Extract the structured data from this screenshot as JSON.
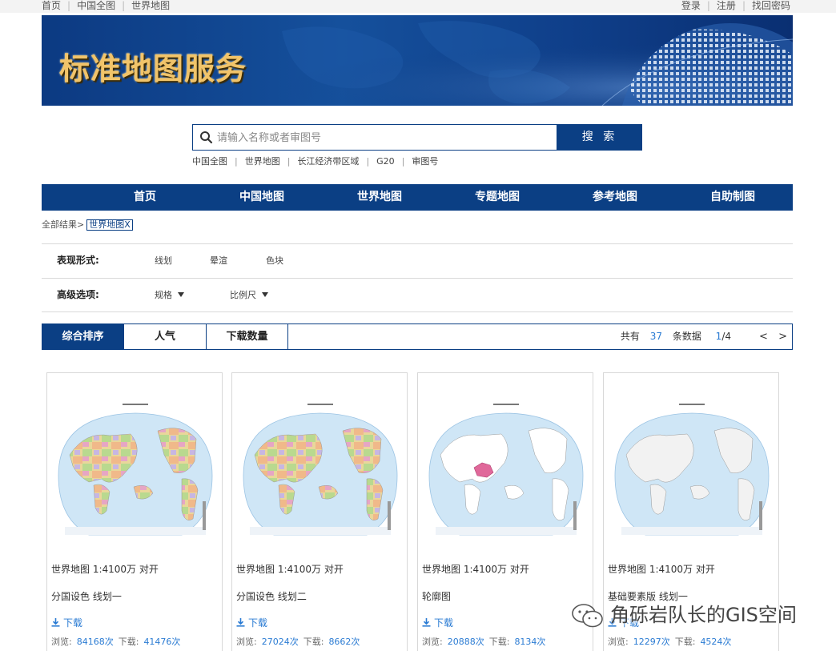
{
  "top_links": {
    "left": [
      "首页",
      "中国全图",
      "世界地图"
    ],
    "right": [
      "登录",
      "注册",
      "找回密码"
    ]
  },
  "banner": {
    "title": "标准地图服务"
  },
  "search": {
    "placeholder": "请输入名称或者审图号",
    "button": "搜 索",
    "quick_links": [
      "中国全图",
      "世界地图",
      "长江经济带区域",
      "G20",
      "审图号"
    ]
  },
  "nav": [
    "首页",
    "中国地图",
    "世界地图",
    "专题地图",
    "参考地图",
    "自助制图"
  ],
  "breadcrumb": {
    "prefix": "全部结果>",
    "tag": "世界地图X"
  },
  "filters": {
    "form_label": "表现形式:",
    "form_options": [
      "线划",
      "晕渲",
      "色块"
    ],
    "advanced_label": "高级选项:",
    "advanced_options": [
      "规格",
      "比例尺"
    ]
  },
  "sortbar": {
    "tabs": [
      "综合排序",
      "人气",
      "下载数量"
    ],
    "count_prefix": "共有",
    "count_value": "37",
    "count_suffix": "条数据",
    "page_current": "1",
    "page_total": "/4",
    "prev": "<",
    "next": ">"
  },
  "cards": [
    {
      "name": "世界地图 1:4100万 对开",
      "sub": "分国设色 线划一",
      "download": "下载",
      "views_label": "浏览:",
      "views": "84168次",
      "downloads_label": "下载:",
      "downloads": "41476次",
      "style": "political"
    },
    {
      "name": "世界地图 1:4100万 对开",
      "sub": "分国设色 线划二",
      "download": "下载",
      "views_label": "浏览:",
      "views": "27024次",
      "downloads_label": "下载:",
      "downloads": "8662次",
      "style": "political"
    },
    {
      "name": "世界地图 1:4100万 对开",
      "sub": "轮廓图",
      "download": "下载",
      "views_label": "浏览:",
      "views": "20888次",
      "downloads_label": "下载:",
      "downloads": "8134次",
      "style": "outline"
    },
    {
      "name": "世界地图 1:4100万 对开",
      "sub": "基础要素版 线划一",
      "download": "下载",
      "views_label": "浏览:",
      "views": "12297次",
      "downloads_label": "下载:",
      "downloads": "4524次",
      "style": "basic"
    }
  ],
  "watermark": {
    "text": "角砾岩队长的GIS空间",
    "icon": "wechat-icon"
  },
  "colors": {
    "brand_blue": "#0b3f84",
    "link_blue": "#2a7bd3",
    "banner_gold": "#f1c46a"
  }
}
